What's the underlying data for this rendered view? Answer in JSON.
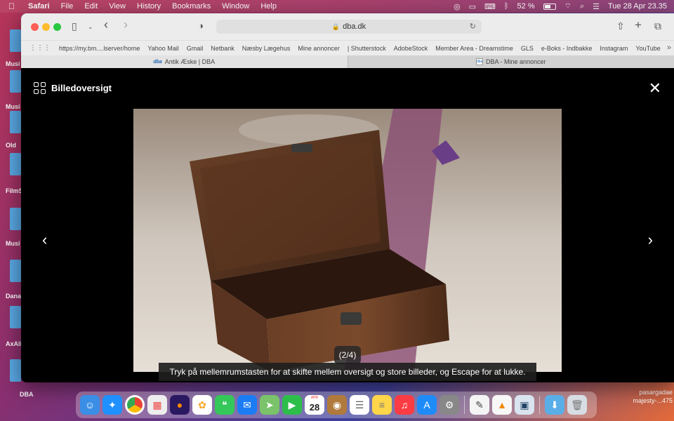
{
  "menubar": {
    "app": "Safari",
    "items": [
      "File",
      "Edit",
      "View",
      "History",
      "Bookmarks",
      "Window",
      "Help"
    ],
    "battery": "52 %",
    "datetime": "Tue 28 Apr  23.35"
  },
  "desktop": {
    "left_labels": [
      "Musi",
      "Musi",
      "Old",
      "FilmS",
      "Musi",
      "Dana",
      "AxAli",
      "DBA"
    ],
    "right_labels": [
      "pasargadae",
      "majesty-...475"
    ]
  },
  "browser": {
    "url": "dba.dk",
    "bookmarks": [
      "https://my.bm....lserver/home",
      "Yahoo Mail",
      "Gmail",
      "Netbank",
      "Næsby Lægehus",
      "Mine annoncer",
      "| Shutterstock",
      "AdobeStock",
      "Member Area - Dreamstime",
      "GLS",
      "e-Boks - Indbakke",
      "Instagram",
      "YouTube"
    ],
    "tabs": [
      {
        "favicon": "dba",
        "title": "Antik Æske | DBA"
      },
      {
        "favicon": "dba",
        "title": "DBA - Mine annoncer"
      }
    ]
  },
  "lightbox": {
    "title": "Billedoversigt",
    "counter": "(2/4)",
    "hint": "Tryk på mellemrumstasten for at skifte mellem oversigt og store billeder, og Escape for at lukke."
  },
  "dock": {
    "calendar_month": "APR",
    "calendar_day": "28",
    "apps": [
      "finder-icon",
      "safari-icon",
      "chrome-icon",
      "launchpad-icon",
      "firefox-icon",
      "photos-icon",
      "messages-icon",
      "mail-icon",
      "maps-icon",
      "facetime-icon",
      "calendar-icon",
      "contacts-icon",
      "reminders-icon",
      "notes-icon",
      "music-icon",
      "app-store-icon",
      "system-preferences-icon",
      "textedit-icon",
      "vlc-icon",
      "preview-icon",
      "downloads-icon",
      "trash-icon"
    ]
  },
  "colors": {
    "tl_red": "#fe5f57",
    "tl_yellow": "#febc2e",
    "tl_green": "#28c840",
    "box_wood": "#5a3520"
  }
}
